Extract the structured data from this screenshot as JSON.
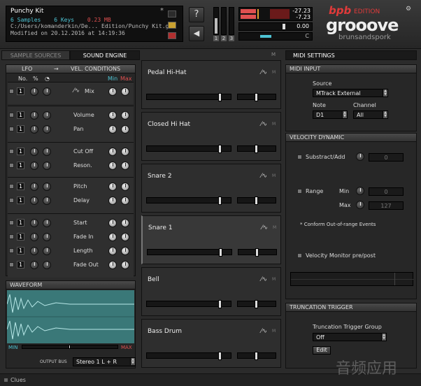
{
  "info": {
    "kit_name": "Punchy Kit",
    "samples": "6 Samples",
    "keys": "6 Keys",
    "size": "0.23 MB",
    "path": "C:/Users/komanderkin/De... Edition/Punchy Kit.grk",
    "modified": "Modified on 20.12.2016 at 14:19:36",
    "close_mark": "*"
  },
  "top": {
    "help_label": "?",
    "level_top": "-27.23",
    "level_bottom": "-7.23",
    "counter": "0.00",
    "c_label": "C",
    "meter_nums": [
      "1",
      "2",
      "3"
    ],
    "brand_bpb": "bpb",
    "brand_edition": "EDITION",
    "brand_groove": "grooove",
    "brand_sub": "brunsandspork"
  },
  "tabs": {
    "sample_sources": "SAMPLE SOURCES",
    "sound_engine": "SOUND ENGINE",
    "midi_settings": "MIDI SETTINGS",
    "mid_mark": "M"
  },
  "lfo": {
    "lfo_label": "LFO",
    "arrow": "→",
    "vel_label": "VEL. CONDITIONS",
    "col_no": "No.",
    "col_pct": "%",
    "min": "Min",
    "max": "Max",
    "params": [
      {
        "label": "Mix",
        "num": "1"
      },
      {
        "label": "Volume",
        "num": "1"
      },
      {
        "label": "Pan",
        "num": "1"
      },
      {
        "label": "Cut Off",
        "num": "1"
      },
      {
        "label": "Reson.",
        "num": "1"
      },
      {
        "label": "Pitch",
        "num": "1"
      },
      {
        "label": "Delay",
        "num": "1"
      },
      {
        "label": "Start",
        "num": "1"
      },
      {
        "label": "Fade In",
        "num": "1"
      },
      {
        "label": "Length",
        "num": "1"
      },
      {
        "label": "Fade Out",
        "num": "1"
      }
    ]
  },
  "waveform": {
    "title": "WAVEFORM",
    "min": "MIN",
    "max": "MAX",
    "output_bus_label": "OUTPUT BUS",
    "output_bus_value": "Stereo 1 L + R"
  },
  "slots": [
    {
      "name": "Pedal Hi-Hat"
    },
    {
      "name": "Closed Hi Hat"
    },
    {
      "name": "Snare 2"
    },
    {
      "name": "Snare 1"
    },
    {
      "name": "Bell"
    },
    {
      "name": "Bass Drum"
    }
  ],
  "midi_input": {
    "title": "MIDI INPUT",
    "source_label": "Source",
    "source_value": "MTrack External",
    "note_label": "Note",
    "note_value": "D1",
    "channel_label": "Channel",
    "channel_value": "All"
  },
  "velocity": {
    "title": "VELOCITY DYNAMIC",
    "substract_label": "Substract/Add",
    "substract_value": "0",
    "range_label": "Range",
    "min_label": "Min",
    "min_value": "0",
    "max_label": "Max",
    "max_value": "127",
    "conform_label": "* Conform Out-of-range Events",
    "monitor_label": "Velocity Monitor pre/post"
  },
  "truncation": {
    "title": "TRUNCATION TRIGGER",
    "group_label": "Truncation Trigger Group",
    "group_value": "Off",
    "edit_label": "Edit"
  },
  "status": {
    "clues_label": "Clues",
    "watermark": "音频应用"
  },
  "colors": {
    "cyan": "#4ec3d3",
    "red": "#e05050",
    "waveform": "#5aa8a8",
    "brand_red": "#e03a3a"
  }
}
